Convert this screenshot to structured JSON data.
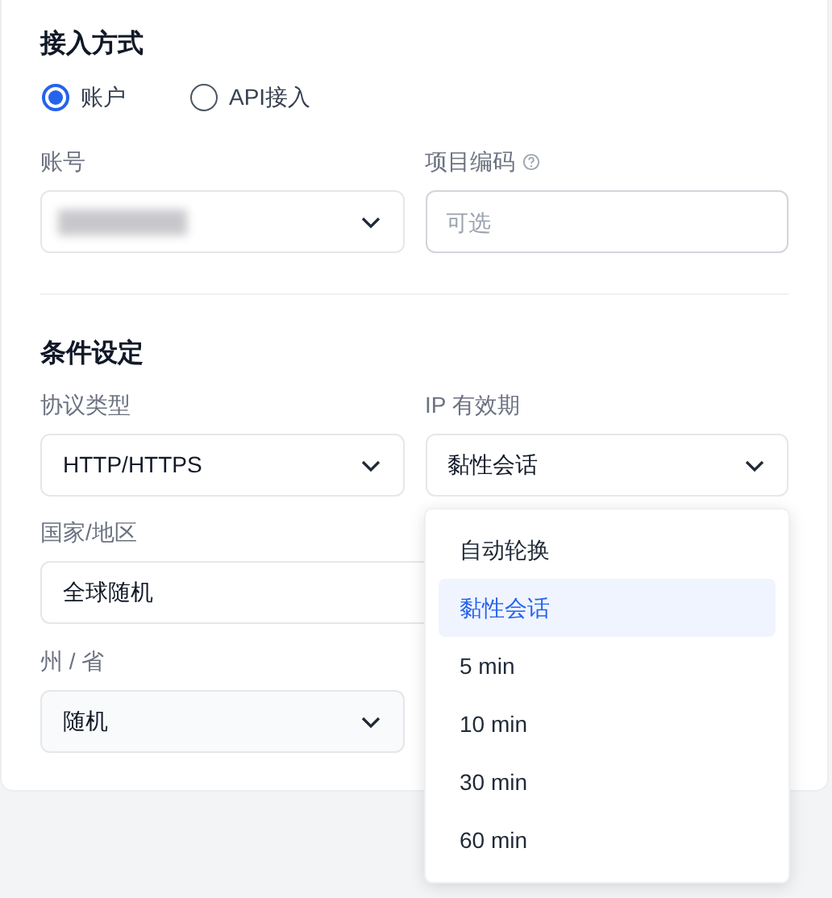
{
  "access_section": {
    "title": "接入方式",
    "methods": [
      {
        "label": "账户",
        "selected": true
      },
      {
        "label": "API接入",
        "selected": false
      }
    ],
    "account": {
      "label": "账号",
      "redacted": true
    },
    "project_code": {
      "label": "项目编码",
      "placeholder": "可选"
    }
  },
  "condition_section": {
    "title": "条件设定",
    "protocol": {
      "label": "协议类型",
      "value": "HTTP/HTTPS"
    },
    "ip_validity": {
      "label": "IP 有效期",
      "value": "黏性会话",
      "expanded": true,
      "options": [
        {
          "label": "自动轮换",
          "selected": false
        },
        {
          "label": "黏性会话",
          "selected": true
        },
        {
          "label": "5 min",
          "selected": false
        },
        {
          "label": "10 min",
          "selected": false
        },
        {
          "label": "30 min",
          "selected": false
        },
        {
          "label": "60 min",
          "selected": false
        }
      ]
    },
    "country": {
      "label": "国家/地区",
      "value": "全球随机"
    },
    "state": {
      "label": "州 / 省",
      "value": "随机"
    }
  }
}
